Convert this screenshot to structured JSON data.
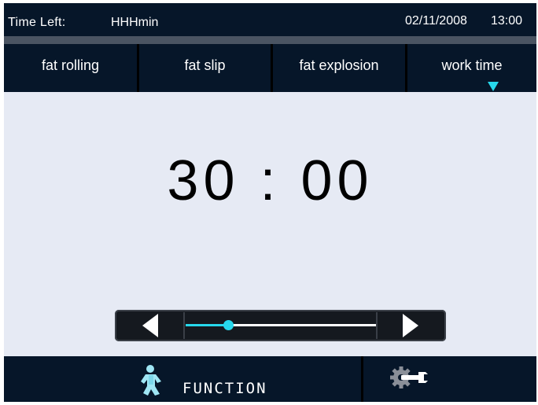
{
  "status": {
    "time_left_label": "Time Left:",
    "time_left_value": "HHHmin",
    "date": "02/11/2008",
    "time": "13:00"
  },
  "tabs": [
    {
      "label": "fat rolling",
      "active": false
    },
    {
      "label": "fat slip",
      "active": false
    },
    {
      "label": "fat explosion",
      "active": false
    },
    {
      "label": "work time",
      "active": true
    }
  ],
  "timer": {
    "display": "30 : 00"
  },
  "slider": {
    "level": 0.22
  },
  "bottom": {
    "function_label": "FUNCTION"
  },
  "icons": {
    "function": "person-icon",
    "settings": "gear-wrench-icon",
    "tab_indicator": "triangle-down-icon"
  },
  "colors": {
    "bar_background": "#061629",
    "screen_background": "#e6eaf4",
    "accent": "#27d8ec"
  }
}
